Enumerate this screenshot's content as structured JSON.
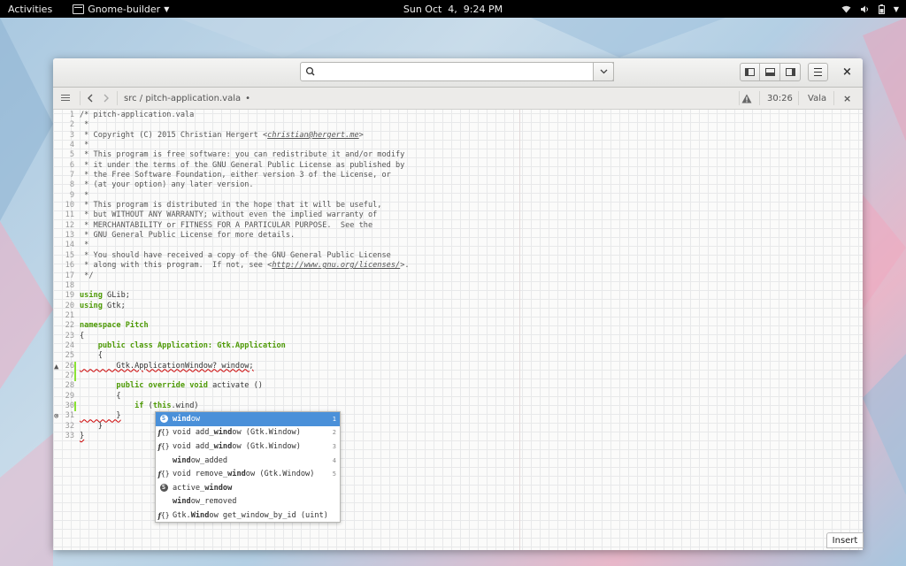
{
  "topbar": {
    "activities": "Activities",
    "app_name": "Gnome-builder",
    "clock": "Sun Oct  4,  9:24 PM"
  },
  "header": {
    "search_value": "",
    "close_label": "×"
  },
  "docbar": {
    "path": "src / pitch-application.vala",
    "modified_dot": "•",
    "position": "30:26",
    "language": "Vala",
    "close_label": "×"
  },
  "editor": {
    "lines": [
      {
        "n": "1",
        "t": "/* pitch-application.vala"
      },
      {
        "n": "2",
        "t": " *"
      },
      {
        "n": "3",
        "t": " * Copyright (C) 2015 Christian Hergert <",
        "url": "christian@hergert.me",
        "tail": ">"
      },
      {
        "n": "4",
        "t": " *"
      },
      {
        "n": "5",
        "t": " * This program is free software: you can redistribute it and/or modify"
      },
      {
        "n": "6",
        "t": " * it under the terms of the GNU General Public License as published by"
      },
      {
        "n": "7",
        "t": " * the Free Software Foundation, either version 3 of the License, or"
      },
      {
        "n": "8",
        "t": " * (at your option) any later version."
      },
      {
        "n": "9",
        "t": " *"
      },
      {
        "n": "10",
        "t": " * This program is distributed in the hope that it will be useful,"
      },
      {
        "n": "11",
        "t": " * but WITHOUT ANY WARRANTY; without even the implied warranty of"
      },
      {
        "n": "12",
        "t": " * MERCHANTABILITY or FITNESS FOR A PARTICULAR PURPOSE.  See the"
      },
      {
        "n": "13",
        "t": " * GNU General Public License for more details."
      },
      {
        "n": "14",
        "t": " *"
      },
      {
        "n": "15",
        "t": " * You should have received a copy of the GNU General Public License"
      },
      {
        "n": "16",
        "t": " * along with this program.  If not, see <",
        "url": "http://www.gnu.org/licenses/",
        "tail": ">."
      },
      {
        "n": "17",
        "t": " */"
      },
      {
        "n": "18",
        "t": ""
      },
      {
        "n": "19",
        "kw": "using",
        "t": " GLib;"
      },
      {
        "n": "20",
        "kw": "using",
        "t": " Gtk;"
      },
      {
        "n": "21",
        "t": ""
      },
      {
        "n": "22",
        "kw": "namespace",
        "ty": " Pitch",
        "t": ""
      },
      {
        "n": "23",
        "t": "{"
      },
      {
        "n": "24",
        "pre": "    ",
        "kw": "public class",
        "ty": " Application: Gtk.Application",
        "t": ""
      },
      {
        "n": "25",
        "t": "    {"
      },
      {
        "n": "26",
        "t": "        Gtk.ApplicationWindow? window;"
      },
      {
        "n": "27",
        "t": ""
      },
      {
        "n": "28",
        "pre": "        ",
        "kw": "public override void",
        "t": " activate ()"
      },
      {
        "n": "29",
        "t": "        {"
      },
      {
        "n": "30",
        "pre": "            ",
        "kw": "if",
        "t": " (",
        "kw2": "this",
        "t2": ".wind)"
      },
      {
        "n": "31",
        "t": "        }"
      },
      {
        "n": "32",
        "t": "    }"
      },
      {
        "n": "33",
        "t": "}"
      }
    ]
  },
  "completion": {
    "items": [
      {
        "icon": "S",
        "pre": "",
        "bold": "wind",
        "post": "ow",
        "num": "1"
      },
      {
        "icon": "f",
        "pre": "void add_",
        "bold": "wind",
        "post": "ow (Gtk.Window)",
        "num": "2"
      },
      {
        "icon": "f",
        "pre": "void add_",
        "bold": "wind",
        "post": "ow (Gtk.Window)",
        "num": "3"
      },
      {
        "icon": "",
        "pre": "",
        "bold": "wind",
        "post": "ow_added",
        "num": "4"
      },
      {
        "icon": "f",
        "pre": "void remove_",
        "bold": "wind",
        "post": "ow (Gtk.Window)",
        "num": "5"
      },
      {
        "icon": "S",
        "pre": "active_",
        "bold": "window",
        "post": "",
        "num": ""
      },
      {
        "icon": "",
        "pre": "",
        "bold": "wind",
        "post": "ow_removed",
        "num": ""
      },
      {
        "icon": "f",
        "pre": "Gtk.",
        "bold": "Wind",
        "post": "ow get_window_by_id (uint)",
        "num": ""
      }
    ]
  },
  "statusbar": {
    "mode": "Insert"
  }
}
